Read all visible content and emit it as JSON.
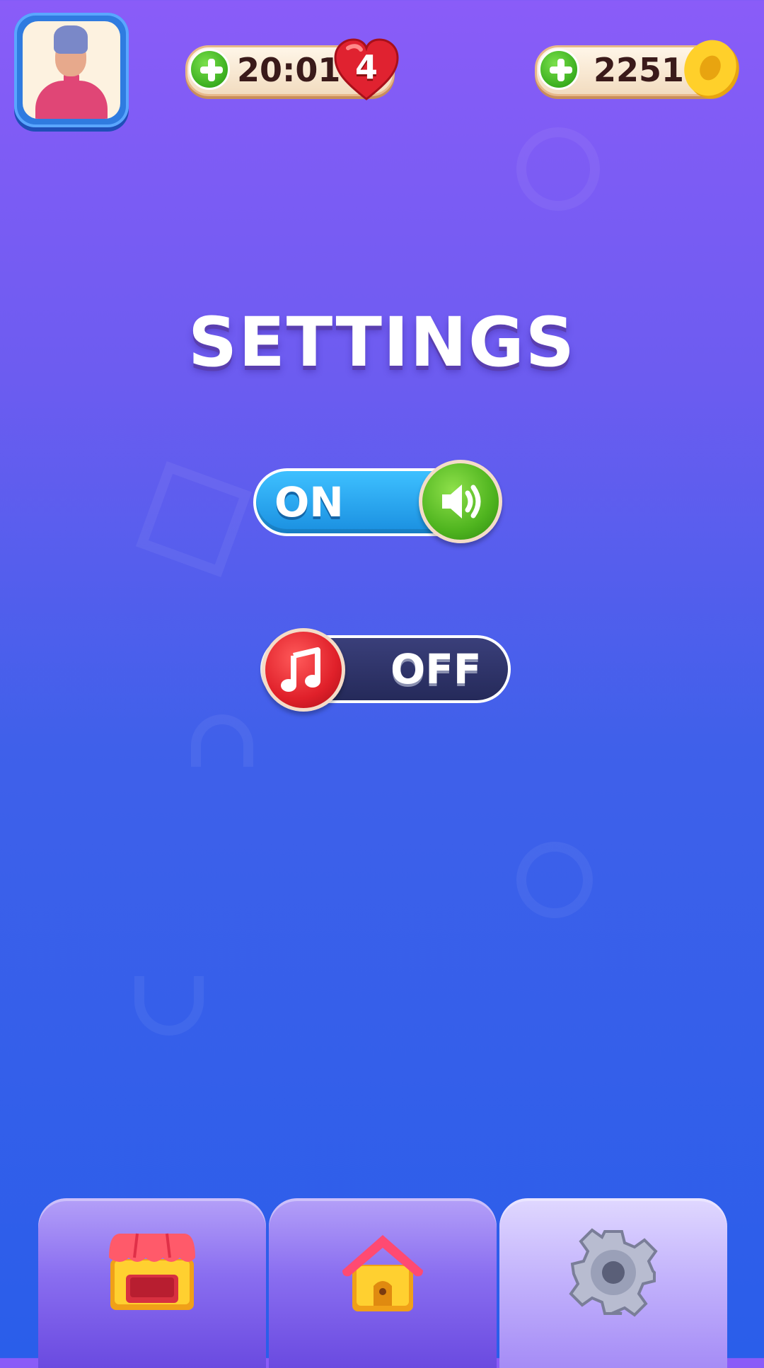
{
  "hud": {
    "lives_timer": "20:01",
    "lives_count": "4",
    "coins": "2251"
  },
  "settings": {
    "title": "SETTINGS",
    "sound_toggle": {
      "label": "ON",
      "state": "on",
      "icon": "speaker-icon"
    },
    "music_toggle": {
      "label": "OFF",
      "state": "off",
      "icon": "music-note-icon"
    }
  },
  "nav": {
    "tabs": [
      {
        "icon": "shop-icon",
        "active": false
      },
      {
        "icon": "home-icon",
        "active": false
      },
      {
        "icon": "gear-icon",
        "active": true
      }
    ]
  },
  "colors": {
    "toggle_on": "#1a8fe0",
    "toggle_off": "#252a5a",
    "sound_knob": "#4fb41f",
    "music_knob": "#e0202a"
  }
}
